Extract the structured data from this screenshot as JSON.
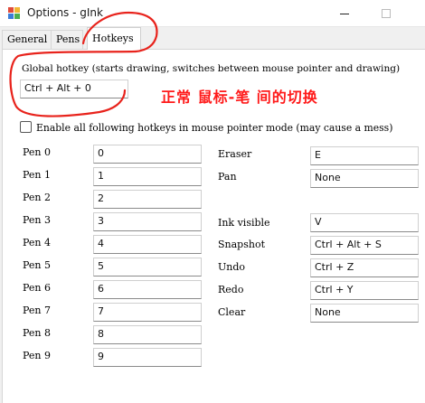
{
  "window": {
    "title": "Options - gInk",
    "icon": "app-icon",
    "controls": [
      "minimize-icon",
      "maximize-icon"
    ]
  },
  "tabs": [
    {
      "label": "General",
      "selected": false
    },
    {
      "label": "Pens",
      "selected": false
    },
    {
      "label": "Hotkeys",
      "selected": true
    }
  ],
  "global_hotkey": {
    "label": "Global hotkey (starts drawing, switches between mouse pointer and drawing)",
    "value": "Ctrl + Alt + 0"
  },
  "annotation": {
    "text": "正常 鼠标-笔 间的切换",
    "color": "#ff1a1a"
  },
  "enable_checkbox": {
    "label": "Enable all following hotkeys in mouse pointer mode (may cause a mess)",
    "checked": false
  },
  "pens": [
    {
      "label": "Pen 0",
      "value": "0"
    },
    {
      "label": "Pen 1",
      "value": "1"
    },
    {
      "label": "Pen 2",
      "value": "2"
    },
    {
      "label": "Pen 3",
      "value": "3"
    },
    {
      "label": "Pen 4",
      "value": "4"
    },
    {
      "label": "Pen 5",
      "value": "5"
    },
    {
      "label": "Pen 6",
      "value": "6"
    },
    {
      "label": "Pen 7",
      "value": "7"
    },
    {
      "label": "Pen 8",
      "value": "8"
    },
    {
      "label": "Pen 9",
      "value": "9"
    }
  ],
  "tools": [
    {
      "label": "Eraser",
      "value": "E"
    },
    {
      "label": "Pan",
      "value": "None"
    },
    {
      "label": "Ink visible",
      "value": "V"
    },
    {
      "label": "Snapshot",
      "value": "Ctrl + Alt + S"
    },
    {
      "label": "Undo",
      "value": "Ctrl + Z"
    },
    {
      "label": "Redo",
      "value": "Ctrl + Y"
    },
    {
      "label": "Clear",
      "value": "None"
    }
  ]
}
